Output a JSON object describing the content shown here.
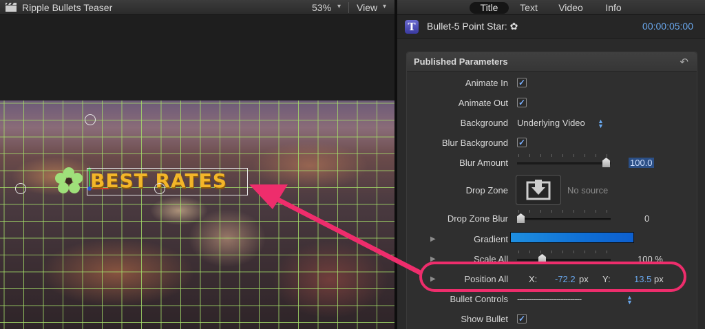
{
  "viewer": {
    "title": "Ripple Bullets Teaser",
    "zoom": "53%",
    "view_label": "View",
    "overlay_text": "BEST RATES"
  },
  "inspector": {
    "tabs": [
      "Title",
      "Text",
      "Video",
      "Info"
    ],
    "active_tab": "Title",
    "clip_name": "Bullet-5 Point Star: ✿",
    "duration": "00:00:05:00",
    "section_title": "Published Parameters",
    "params": {
      "animate_in": {
        "label": "Animate In",
        "checked": true
      },
      "animate_out": {
        "label": "Animate Out",
        "checked": true
      },
      "background": {
        "label": "Background",
        "value": "Underlying Video"
      },
      "blur_background": {
        "label": "Blur Background",
        "checked": true
      },
      "blur_amount": {
        "label": "Blur Amount",
        "value": "100.0"
      },
      "drop_zone": {
        "label": "Drop Zone",
        "value": "No source"
      },
      "drop_zone_blur": {
        "label": "Drop Zone Blur",
        "value": "0"
      },
      "gradient": {
        "label": "Gradient"
      },
      "scale_all": {
        "label": "Scale All",
        "value": "100 %"
      },
      "position_all": {
        "label": "Position All",
        "x_label": "X:",
        "x_value": "-72.2",
        "x_unit": "px",
        "y_label": "Y:",
        "y_value": "13.5",
        "y_unit": "px"
      },
      "bullet_controls": {
        "label": "Bullet Controls",
        "value": "----------------------------"
      },
      "show_bullet": {
        "label": "Show Bullet",
        "checked": true
      }
    }
  },
  "colors": {
    "accent_blue": "#6aa8ee",
    "callout_pink": "#ee2d6c",
    "title_gold": "#f3b629",
    "grid_green": "#a6e06a"
  },
  "icons": [
    "clapperboard-icon",
    "chevron-down-icon",
    "title-t-icon",
    "reset-arrow-icon",
    "flower-bullet-icon",
    "checkmark-icon",
    "disclosure-triangle-icon",
    "popup-arrows-icon",
    "drop-zone-arrow-icon"
  ]
}
